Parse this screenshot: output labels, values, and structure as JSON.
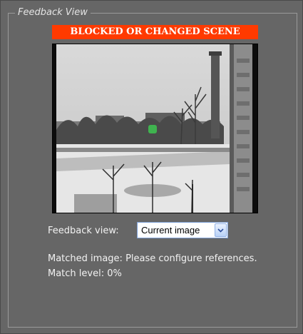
{
  "panel": {
    "legend": "Feedback View",
    "alert_banner": "BLOCKED OR CHANGED SCENE",
    "feedback_view_label": "Feedback view:",
    "feedback_view_selected": "Current image",
    "matched_image_label": "Matched image:",
    "matched_image_value": "Please configure references.",
    "match_level_label": "Match level:",
    "match_level_value": "0%"
  },
  "colors": {
    "panel_bg": "#666666",
    "banner_bg": "#ff3a00",
    "detection_marker": "#3fb34f"
  },
  "icons": {
    "dropdown": "chevron-down-icon"
  }
}
